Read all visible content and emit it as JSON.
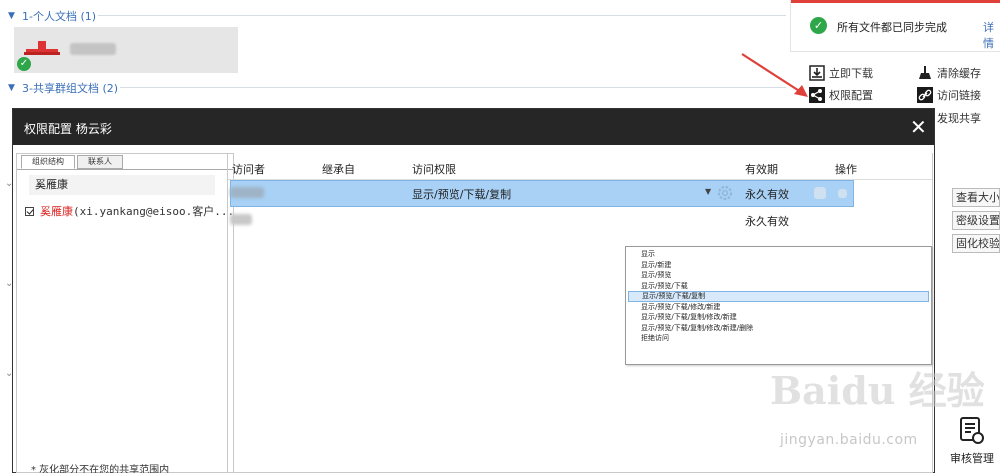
{
  "background": {
    "section1_title": "1-个人文档 (1)",
    "section2_title": "3-共享群组文档 (2)"
  },
  "right_panel": {
    "sync_status": "所有文件都已同步完成",
    "details_link": "详情",
    "actions": {
      "download_now": "立即下载",
      "clear_cache": "清除缓存",
      "permission_config": "权限配置",
      "access_link": "访问链接",
      "discover_share": "发现共享"
    },
    "buttons": {
      "view_size": "查看大小",
      "security_setting": "密级设置",
      "solidify_check": "固化校验"
    },
    "audit_label": "审核管理"
  },
  "dialog": {
    "title": "权限配置 杨云彩",
    "close_symbol": "✕",
    "tabs": [
      "组织结构",
      "联系人"
    ],
    "tree_node": "奚雁康",
    "member": {
      "name": "奚雁康",
      "email": "(xi.yankang@eisoo.客户..."
    },
    "note": "* 灰化部分不在您的共享范围内",
    "table": {
      "headers": {
        "visitor": "访问者",
        "inherit_from": "继承自",
        "access_permission": "访问权限",
        "validity": "有效期",
        "operation": "操作"
      },
      "rows": [
        {
          "permission": "显示/预览/下载/复制",
          "validity": "永久有效"
        },
        {
          "permission": "",
          "validity": "永久有效"
        }
      ]
    },
    "permission_options": [
      "显示",
      "显示/新建",
      "显示/预览",
      "显示/预览/下载",
      "显示/预览/下载/复制",
      "显示/预览/下载/修改/新建",
      "显示/预览/下载/复制/修改/新建",
      "显示/预览/下载/复制/修改/新建/删除",
      "拒绝访问"
    ],
    "selected_option_index": 4
  },
  "watermark": {
    "brand": "Bai du 经验",
    "url": "jingyan.baidu.com"
  },
  "colors": {
    "dialog_header": "#262626",
    "selected_row": "#a8d1f5",
    "link_blue": "#3a6fb7",
    "ok_green": "#2ea64a",
    "arrow_red": "#e0403a"
  }
}
